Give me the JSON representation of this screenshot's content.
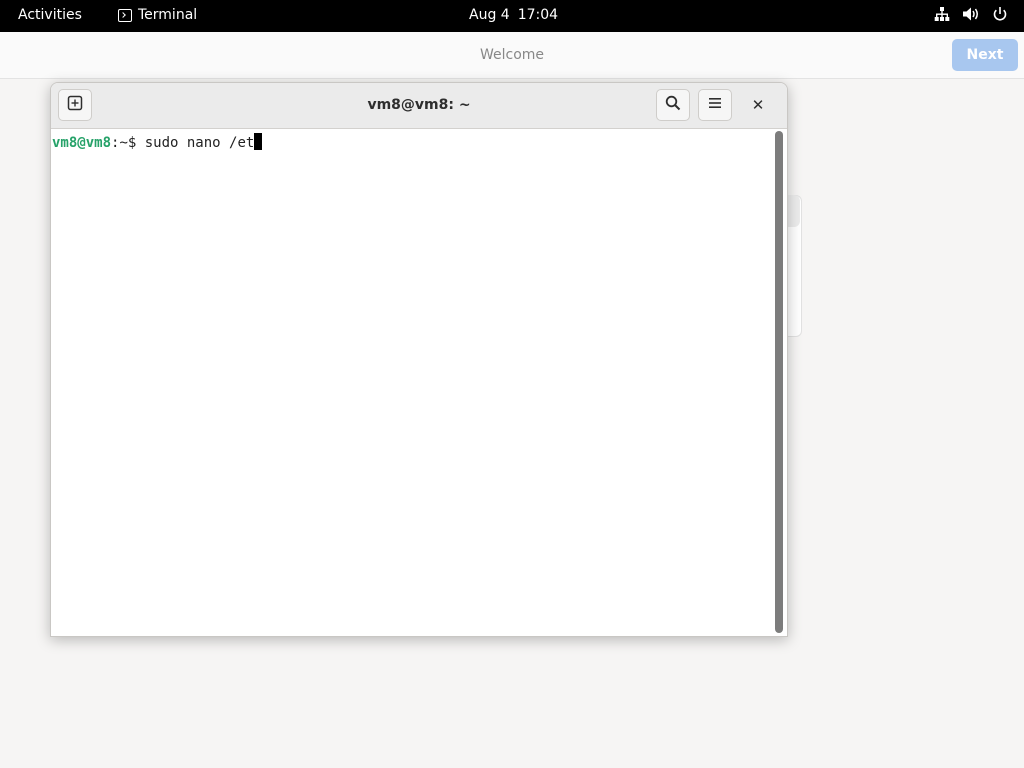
{
  "topbar": {
    "activities": "Activities",
    "app_name": "Terminal",
    "date": "Aug 4",
    "time": "17:04",
    "icons": [
      "network-icon",
      "volume-icon",
      "power-icon"
    ]
  },
  "welcome": {
    "title": "Welcome",
    "next_label": "Next"
  },
  "terminal": {
    "title": "vm8@vm8: ~",
    "prompt_user": "vm8@vm8",
    "prompt_path": ":~$ ",
    "command": "sudo nano /et",
    "close_symbol": "✕"
  },
  "colors": {
    "prompt_green": "#26a269",
    "next_button": "#a8c7ef"
  }
}
